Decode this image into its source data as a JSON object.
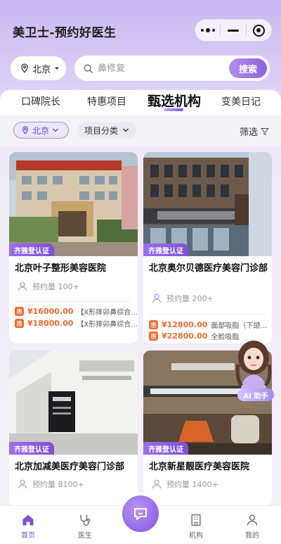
{
  "app": {
    "title": "美卫士-预约好医生"
  },
  "search": {
    "city": "北京",
    "placeholder": "鼻修复",
    "button": "搜索"
  },
  "tabs": [
    {
      "label": "口碑院长",
      "active": false
    },
    {
      "label": "特惠项目",
      "active": false
    },
    {
      "label": "甄选机构",
      "active": true
    },
    {
      "label": "变美日记",
      "active": false
    }
  ],
  "filters": {
    "city": "北京",
    "category": "项目分类",
    "screen": "筛选"
  },
  "cards": [
    {
      "badge": "齐雅登认证",
      "name": "北京叶子整形美容医院",
      "sales": "预约量 100+",
      "prices": [
        {
          "tag": "惠",
          "price": "¥16000.00",
          "title": "【X形摔卯鼻综合..."
        },
        {
          "tag": "惠",
          "price": "¥18000.00",
          "title": "【X形摔卯鼻综合..."
        }
      ]
    },
    {
      "badge": "齐雅登认证",
      "name": "北京奥尔贝德医疗美容门诊部",
      "sales": "预约量 200+",
      "prices": [
        {
          "tag": "惠",
          "price": "¥12800.00",
          "title": "面部吸脂（下颌..."
        },
        {
          "tag": "惠",
          "price": "¥22800.00",
          "title": "全脸吸脂"
        }
      ]
    },
    {
      "badge": "齐雅登认证",
      "name": "北京加减美医疗美容门诊部",
      "sales": "预约量 8100+",
      "prices": []
    },
    {
      "badge": "齐雅登认证",
      "name": "北京新星靓医疗美容医院",
      "sales": "预约量 1400+",
      "prices": []
    }
  ],
  "ai_assistant": {
    "label": "AI 助手"
  },
  "nav": [
    {
      "label": "首页",
      "icon": "home-icon",
      "active": true
    },
    {
      "label": "医生",
      "icon": "stethoscope-icon",
      "active": false
    },
    {
      "label": "",
      "icon": "chat-icon",
      "active": false
    },
    {
      "label": "机构",
      "icon": "building-icon",
      "active": false
    },
    {
      "label": "我的",
      "icon": "user-icon",
      "active": false
    }
  ],
  "colors": {
    "accent": "#8b62e0",
    "price": "#f06b2e",
    "badge": "#7d52d6"
  }
}
